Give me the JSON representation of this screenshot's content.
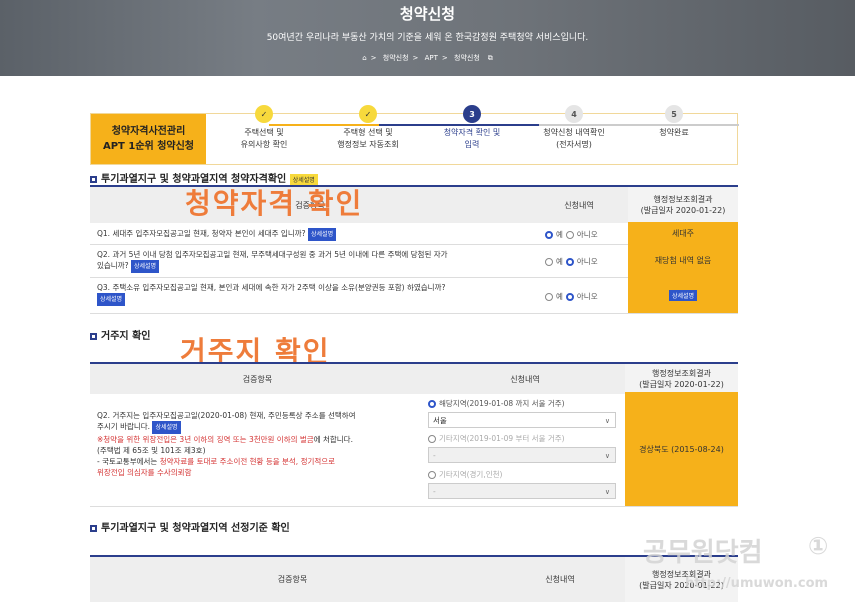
{
  "hero": {
    "title": "청약신청",
    "subtitle": "50여년간 우리나라 부동산 가치의 기준을 세워 온 한국감정원 주택청약 서비스입니다.",
    "crumbs": [
      "청약신청",
      "APT",
      "청약신청"
    ]
  },
  "steps": {
    "badge_line1": "청약자격사전관리",
    "badge_line2": "APT 1순위 청약신청",
    "items": [
      {
        "num": "✓",
        "label1": "주택선택 및",
        "label2": "유의사항 확인"
      },
      {
        "num": "✓",
        "label1": "주택형 선택 및",
        "label2": "행정정보 자동조회"
      },
      {
        "num": "3",
        "label1": "청약자격 확인 및",
        "label2": "입력"
      },
      {
        "num": "4",
        "label1": "청약신청 내역확인",
        "label2": "(전자서명)"
      },
      {
        "num": "5",
        "label1": "청약완료",
        "label2": ""
      }
    ]
  },
  "section1": {
    "title": "투기과열지구 및 청약과열지역 청약자격확인",
    "tag": "상세설명",
    "overlay": "청약자격 확인",
    "col_item": "검증항목",
    "col_apply": "신청내역",
    "col_result": "행정정보조회결과",
    "col_result_date": "(발급일자 2020-01-22)",
    "rows": [
      {
        "q": "Q1. 세대주 입주자모집공고일 현재, 청약자 본인이 세대주 입니까?",
        "tag": "상세설명",
        "yes": "예",
        "no": "아니오",
        "result": "세대주"
      },
      {
        "q": "Q2. 과거 5년 이내 당첨 입주자모집공고일 현재, 무주택세대구성원 중 과거 5년 이내에 다른 주택에 당첨된 자가",
        "q2": "있습니까?",
        "tag": "상세설명",
        "yes": "예",
        "no": "아니오",
        "result": "재당첨 내역 없음"
      },
      {
        "q": "Q3. 주택소유 입주자모집공고일 현재, 본인과 세대에 속한 자가 2주택 이상을 소유(분양권등 포함) 하였습니까?",
        "tag": "상세설명",
        "yes": "예",
        "no": "아니오",
        "result_tag": "상세설명"
      }
    ]
  },
  "section2": {
    "title": "거주지 확인",
    "overlay": "거주지 확인",
    "col_item": "검증항목",
    "col_apply": "신청내역",
    "col_result": "행정정보조회결과",
    "col_result_date": "(발급일자 2020-01-22)",
    "q_line1": "Q2. 거주지는 입주자모집공고일(2020-01-08) 현재, 주민등록상 주소를 선택하여",
    "q_line2": "주시기 바랍니다.",
    "q_tag": "상세설명",
    "warn1_a": "※청약을 위한 위장전입은 3년 이하의 징역 또는 3천만원 이하의 벌금",
    "warn1_b": "에 처합니다.",
    "warn2": "(주택법 제 65조 및 101조 제3호)",
    "warn3_a": "- 국토교통부에서는 ",
    "warn3_b": "청약자료를 토대로 주소이전 현황 등을 분석, 정기적으로",
    "warn4": "위장전입 의심자를 수사의뢰함",
    "opt1": "해당지역(2019-01-08 까지 서울 거주)",
    "opt1_value": "서울",
    "opt2": "기타지역(2019-01-09 부터 서울 거주)",
    "opt2_value": "-",
    "opt3": "기타지역(경기,인천)",
    "opt3_value": "-",
    "result": "경상북도 (2015-08-24)"
  },
  "section3": {
    "title": "투기과열지구 및 청약과열지역 선정기준 확인",
    "col_item": "검증항목",
    "col_apply": "신청내역",
    "col_result": "행정정보조회결과",
    "col_result_date": "(발급일자 2020-01-22)"
  },
  "watermark": {
    "text": "공무원닷컴",
    "url": "http://umuwon.com"
  }
}
